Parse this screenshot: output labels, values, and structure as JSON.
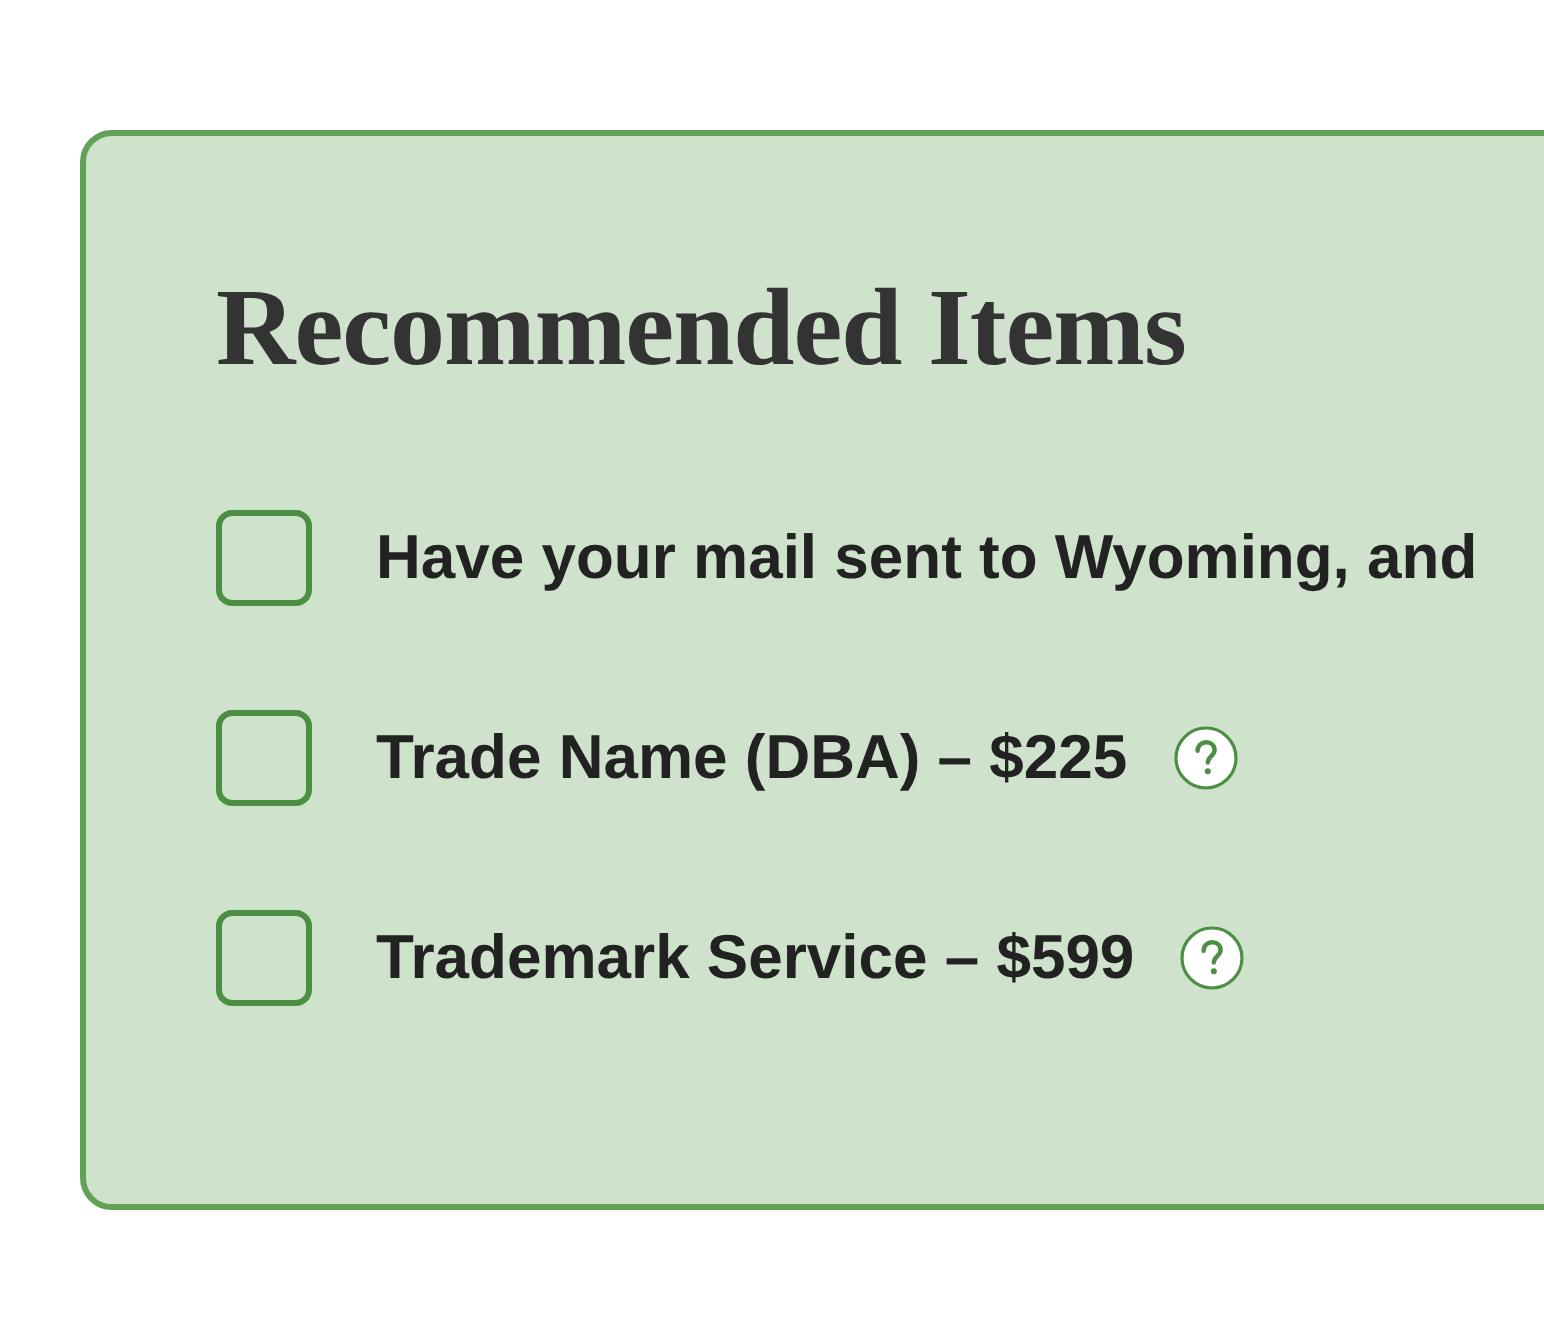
{
  "card": {
    "title": "Recommended Items",
    "items": [
      {
        "label": "Have your mail sent to Wyoming, and",
        "checked": false,
        "help": false
      },
      {
        "label": "Trade Name (DBA) – $225",
        "checked": false,
        "help": true
      },
      {
        "label": "Trademark Service – $599",
        "checked": false,
        "help": true
      }
    ]
  }
}
